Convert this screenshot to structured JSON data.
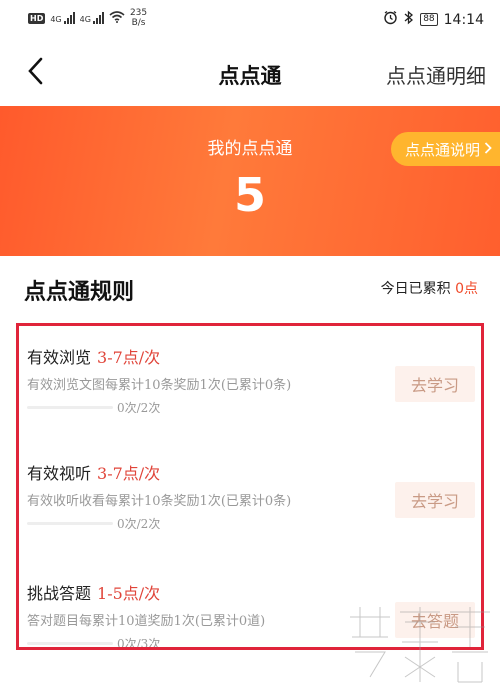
{
  "status_bar": {
    "hd": "HD",
    "net1": "4G",
    "net2": "4G",
    "speed_value": "235",
    "speed_unit": "B/s",
    "battery": "88",
    "time": "14:14"
  },
  "nav": {
    "back_icon": "chevron-left-icon",
    "title": "点点通",
    "detail_link": "点点通明细"
  },
  "banner": {
    "label": "我的点点通",
    "value": "5",
    "explain_button": "点点通说明"
  },
  "rules": {
    "title": "点点通规则",
    "today_prefix": "今日已累积",
    "today_points": "0点"
  },
  "tasks": [
    {
      "name": "有效浏览",
      "points": "3-7点/次",
      "desc": "有效浏览文图每累计10条奖励1次(已累计0条)",
      "progress_text": "0次/2次",
      "progress": 0,
      "button": "去学习"
    },
    {
      "name": "有效视听",
      "points": "3-7点/次",
      "desc": "有效收听收看每累计10条奖励1次(已累计0条)",
      "progress_text": "0次/2次",
      "progress": 0,
      "button": "去学习"
    },
    {
      "name": "挑战答题",
      "points": "1-5点/次",
      "desc": "答对题目每累计10道奖励1次(已累计0道)",
      "progress_text": "0次/3次",
      "progress": 0,
      "button": "去答题"
    }
  ],
  "colors": {
    "accent": "#ff5a2c",
    "explain_bg": "#ffb52e",
    "highlight_border": "#e0243a",
    "points_text": "#e0453a"
  }
}
